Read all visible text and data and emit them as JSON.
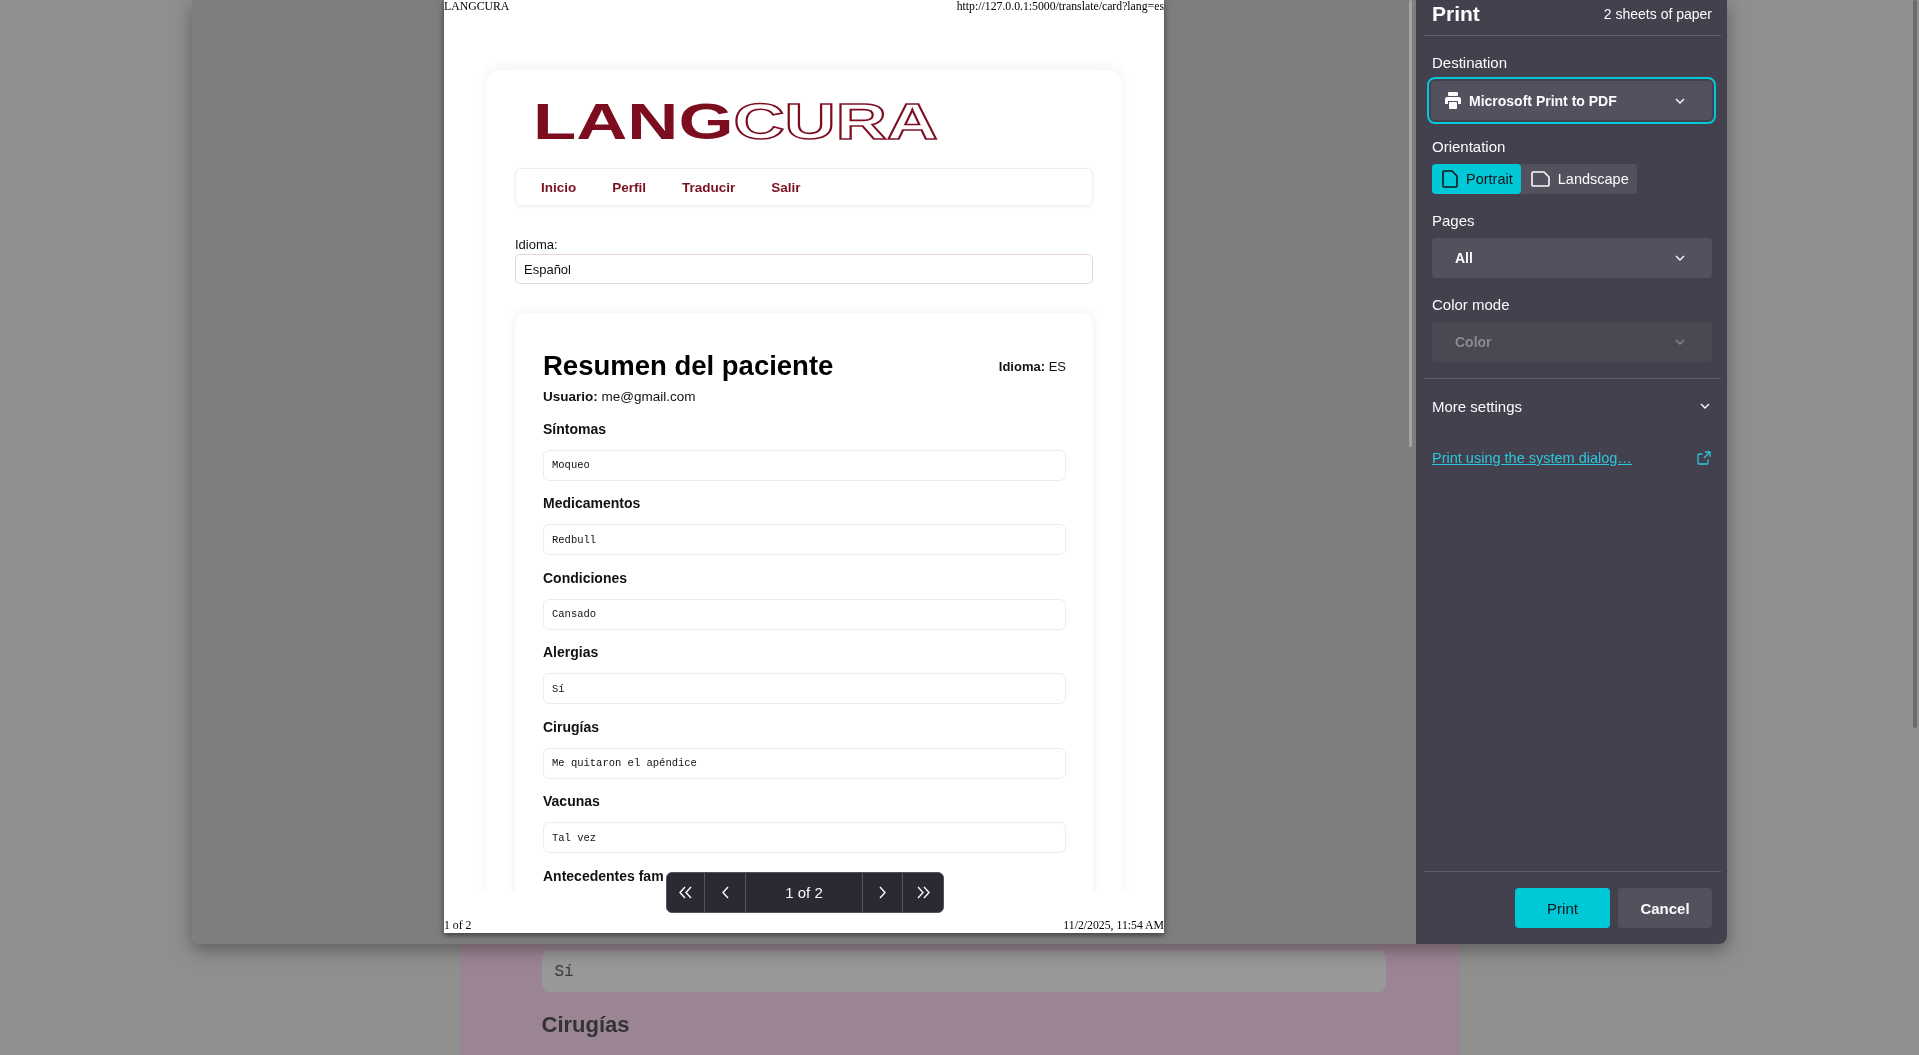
{
  "background_page": {
    "field_value": "Sí",
    "section_heading": "Cirugías"
  },
  "print_preview": {
    "page_header": {
      "title": "LANGCURA",
      "url": "http://127.0.0.1:5000/translate/card?lang=es"
    },
    "logo": {
      "filled": "LANG",
      "outlined": "CURA"
    },
    "nav": [
      {
        "label": "Inicio"
      },
      {
        "label": "Perfil"
      },
      {
        "label": "Traducir"
      },
      {
        "label": "Salir"
      }
    ],
    "language_field": {
      "label": "Idioma:",
      "value": "Español"
    },
    "summary": {
      "title": "Resumen del paciente",
      "language": "**Idioma:** ES",
      "user": "**Usuario:** me@gmail.com",
      "sections": [
        {
          "label": "Síntomas",
          "value": "Moqueo"
        },
        {
          "label": "Medicamentos",
          "value": "Redbull"
        },
        {
          "label": "Condiciones",
          "value": "Cansado"
        },
        {
          "label": "Alergias",
          "value": "Sí"
        },
        {
          "label": "Cirugías",
          "value": "Me quitaron el apéndice"
        },
        {
          "label": "Vacunas",
          "value": "Tal vez"
        },
        {
          "label": "Antecedentes fam"
        }
      ]
    },
    "page_footer": {
      "page": "1 of 2",
      "date": "11/2/2025, 11:54 AM"
    },
    "pager": {
      "page": "1 of 2"
    }
  },
  "print_panel": {
    "title": "Print",
    "sheets": "2 sheets of paper",
    "destination": {
      "label": "Destination",
      "value": "Microsoft Print to PDF",
      "focused": true
    },
    "orientation": {
      "label": "Orientation",
      "options": [
        {
          "label": "Portrait",
          "kind": "portrait",
          "selected": true
        },
        {
          "label": "Landscape",
          "kind": "landscape",
          "selected": false
        }
      ]
    },
    "pages": {
      "label": "Pages",
      "value": "All"
    },
    "color_mode": {
      "label": "Color mode",
      "value": "Color",
      "disabled": true
    },
    "more_settings": {
      "label": "More settings",
      "expanded": false
    },
    "system_dialog_link": "Print using the system dialog…",
    "buttons": [
      {
        "label": "Print",
        "kind": "primary"
      },
      {
        "label": "Cancel",
        "kind": "secondary"
      }
    ]
  }
}
